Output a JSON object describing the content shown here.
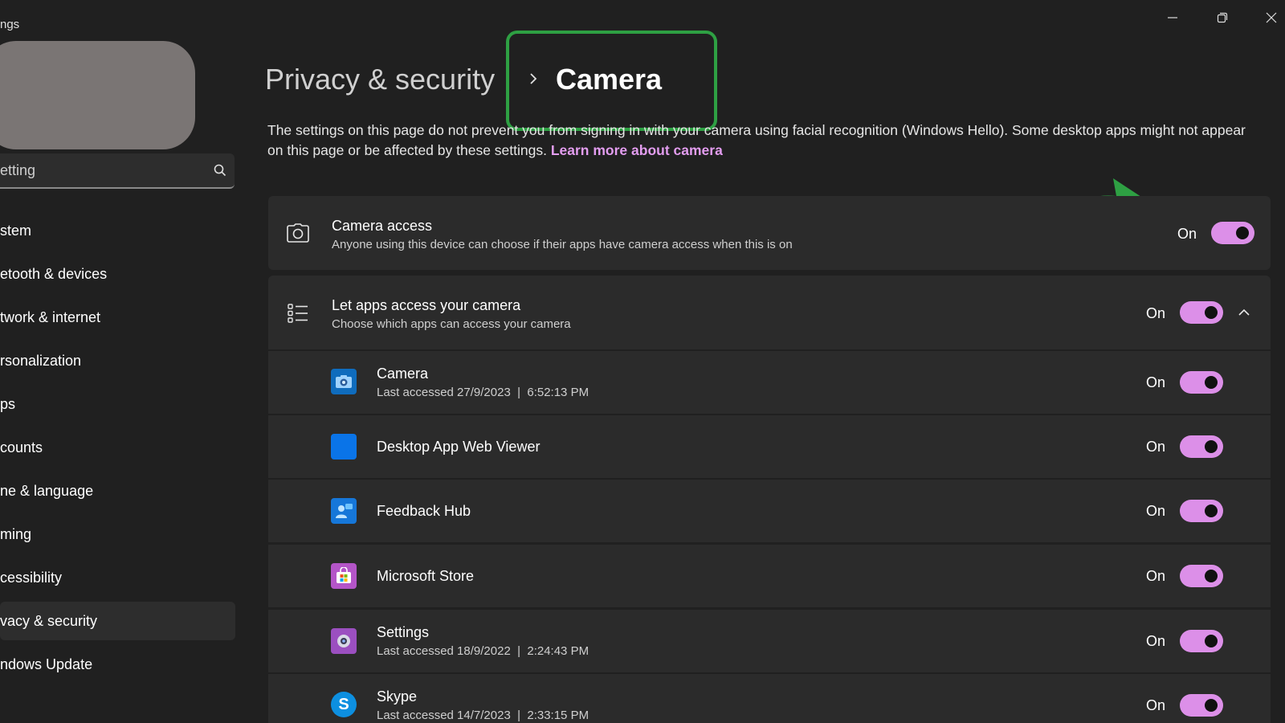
{
  "window": {
    "app_title": "ngs",
    "controls": [
      "minimize-icon",
      "restore-icon",
      "close-icon"
    ]
  },
  "sidebar": {
    "search_placeholder": "etting",
    "items": [
      {
        "label": "stem"
      },
      {
        "label": "etooth & devices"
      },
      {
        "label": "twork & internet"
      },
      {
        "label": "rsonalization"
      },
      {
        "label": "ps"
      },
      {
        "label": "counts"
      },
      {
        "label": "ne & language"
      },
      {
        "label": "ming"
      },
      {
        "label": "cessibility"
      },
      {
        "label": "vacy & security",
        "active": true
      },
      {
        "label": "ndows Update"
      }
    ]
  },
  "header": {
    "breadcrumb_parent": "Privacy & security",
    "breadcrumb_current": "Camera",
    "description_text": "The settings on this page do not prevent you from signing in with your camera using facial recognition (Windows Hello). Some desktop apps might not appear on this page or be affected by these settings.",
    "learn_more": "Learn more about camera"
  },
  "camera_access": {
    "title": "Camera access",
    "subtitle": "Anyone using this device can choose if their apps have camera access when this is on",
    "state_label": "On",
    "enabled": true,
    "icon": "camera-icon"
  },
  "let_apps": {
    "title": "Let apps access your camera",
    "subtitle": "Choose which apps can access your camera",
    "state_label": "On",
    "enabled": true,
    "icon": "list-icon",
    "expanded": true
  },
  "apps": [
    {
      "name": "Camera",
      "last_accessed": "Last accessed 27/9/2023  |  6:52:13 PM",
      "state_label": "On",
      "icon": "camera-app-icon",
      "color": "#0f6cbd"
    },
    {
      "name": "Desktop App Web Viewer",
      "last_accessed": "",
      "state_label": "On",
      "icon": "web-viewer-app-icon",
      "color": "#0a74e8"
    },
    {
      "name": "Feedback Hub",
      "last_accessed": "",
      "state_label": "On",
      "icon": "feedback-hub-app-icon",
      "color": "#1677d9"
    },
    {
      "name": "Microsoft Store",
      "last_accessed": "",
      "state_label": "On",
      "icon": "store-app-icon",
      "color": "#b455c8"
    },
    {
      "name": "Settings",
      "last_accessed": "Last accessed 18/9/2022  |  2:24:43 PM",
      "state_label": "On",
      "icon": "settings-app-icon",
      "color": "#9b4fc0"
    },
    {
      "name": "Skype",
      "last_accessed": "Last accessed 14/7/2023  |  2:33:15 PM",
      "state_label": "On",
      "icon": "skype-app-icon",
      "color": "#0d8fe0"
    }
  ],
  "colors": {
    "background": "#202020",
    "card": "#2b2b2b",
    "accent": "#dc8fe8",
    "highlight": "#2ea043",
    "link": "#e39df0"
  }
}
